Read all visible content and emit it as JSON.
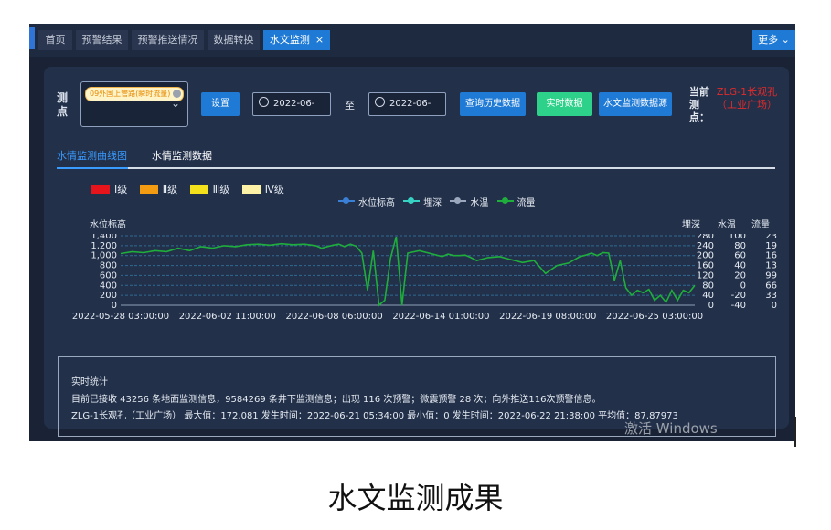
{
  "tabs": [
    {
      "label": "首页"
    },
    {
      "label": "预警结果"
    },
    {
      "label": "预警推送情况"
    },
    {
      "label": "数据转换"
    },
    {
      "label": "水文监测",
      "close": "×"
    }
  ],
  "more_label": "更多",
  "monitor_point_label": "测点",
  "selected_point_tag": "09外国上管路(瞬时流量)",
  "set_button": "设置",
  "date_from": "2022-06-",
  "to_label": "至",
  "date_to": "2022-06-",
  "query_history_button": "查询历史数据",
  "realtime_button": "实时数据",
  "source_button": "水文监测数据源",
  "current_point_label": "当前测点：",
  "current_point_value": "ZLG-1长观孔（工业广场）",
  "subtabs": [
    {
      "label": "水情监测曲线图"
    },
    {
      "label": "水情监测数据"
    }
  ],
  "warn_levels": [
    {
      "label": "Ⅰ级",
      "color": "#e8141b"
    },
    {
      "label": "Ⅱ级",
      "color": "#f39c12"
    },
    {
      "label": "Ⅲ级",
      "color": "#f5e11b"
    },
    {
      "label": "Ⅳ级",
      "color": "#fdf2a6"
    }
  ],
  "chart_data": {
    "type": "line",
    "x": [
      "2022-05-28 03:00:00",
      "2022-06-02 11:00:00",
      "2022-06-08 06:00:00",
      "2022-06-14 01:00:00",
      "2022-06-19 08:00:00",
      "2022-06-25 03:00:00"
    ],
    "series": [
      {
        "name": "水位标高",
        "color": "#3a7fd6",
        "values": []
      },
      {
        "name": "埋深",
        "color": "#36d3c4",
        "values": []
      },
      {
        "name": "水温",
        "color": "#9aa7bd",
        "values": []
      },
      {
        "name": "流量",
        "color": "#1fae3b",
        "x_fraction": [
          0,
          0.02,
          0.04,
          0.06,
          0.08,
          0.1,
          0.12,
          0.14,
          0.16,
          0.18,
          0.2,
          0.22,
          0.24,
          0.26,
          0.28,
          0.3,
          0.32,
          0.34,
          0.35,
          0.36,
          0.37,
          0.38,
          0.39,
          0.4,
          0.41,
          0.42,
          0.43,
          0.44,
          0.45,
          0.46,
          0.47,
          0.48,
          0.49,
          0.5,
          0.52,
          0.54,
          0.56,
          0.57,
          0.58,
          0.59,
          0.6,
          0.61,
          0.62,
          0.64,
          0.66,
          0.68,
          0.7,
          0.72,
          0.74,
          0.76,
          0.78,
          0.8,
          0.81,
          0.82,
          0.83,
          0.84,
          0.85,
          0.86,
          0.87,
          0.88,
          0.89,
          0.9,
          0.91,
          0.92,
          0.93,
          0.94,
          0.95,
          0.96,
          0.97,
          0.98,
          0.99,
          1.0
        ],
        "values": [
          1040,
          1080,
          1060,
          1100,
          1080,
          1150,
          1100,
          1180,
          1150,
          1200,
          1180,
          1220,
          1230,
          1210,
          1240,
          1220,
          1230,
          1200,
          1150,
          1180,
          1210,
          1230,
          1180,
          1230,
          1190,
          1050,
          300,
          1100,
          0,
          100,
          950,
          1380,
          0,
          1050,
          1100,
          1040,
          980,
          1030,
          1000,
          1000,
          1010,
          960,
          900,
          960,
          980,
          920,
          860,
          900,
          640,
          800,
          850,
          980,
          1010,
          1050,
          1000,
          1060,
          1050,
          500,
          900,
          350,
          200,
          300,
          250,
          320,
          100,
          200,
          60,
          300,
          100,
          300,
          250,
          400
        ]
      }
    ],
    "y_left": {
      "label": "水位标高",
      "ticks": [
        "1,400",
        "1,200",
        "1,000",
        "800",
        "600",
        "400",
        "200",
        "0"
      ],
      "range": [
        0,
        1400
      ]
    },
    "y_right": [
      {
        "label": "埋深",
        "ticks": [
          "280",
          "240",
          "200",
          "160",
          "120",
          "80",
          "40",
          "0"
        ]
      },
      {
        "label": "水温",
        "ticks": [
          "100",
          "80",
          "60",
          "40",
          "20",
          "0",
          "-20",
          "-40"
        ]
      },
      {
        "label": "流量",
        "ticks": [
          "23",
          "19",
          "16",
          "13",
          "99",
          "66",
          "33",
          "0"
        ]
      }
    ]
  },
  "stats": {
    "title": "实时统计",
    "line1": "目前已接收 43256 条地面监测信息，9584269 条井下监测信息；出现 116 次预警；微震预警 28 次；向外推送116次预警信息。",
    "line2": "ZLG-1长观孔（工业广场）  最大值：172.081  发生时间：2022-06-21 05:34:00   最小值：0  发生时间：2022-06-22 21:38:00  平均值：87.87973"
  },
  "watermark": "激活 Windows",
  "caption": "水文监测成果"
}
